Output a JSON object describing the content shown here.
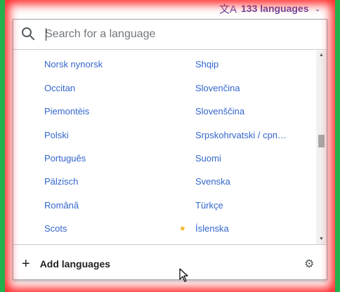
{
  "header": {
    "language_button_label": "133 languages",
    "language_glyph": "文A",
    "chevron": "⌄"
  },
  "search": {
    "placeholder": "Search for a language",
    "icon": "search-icon"
  },
  "languages": {
    "left": [
      "Norsk nynorsk",
      "Occitan",
      "Piemontèis",
      "Polski",
      "Português",
      "Pälzisch",
      "Română",
      "Scots"
    ],
    "right": [
      "Shqip",
      "Slovenčina",
      "Slovenščina",
      "Srpskohrvatski / срп…",
      "Suomi",
      "Svenska",
      "Türkçe",
      "Íslenska"
    ],
    "starred": "Íslenska"
  },
  "footer": {
    "add_languages_label": "Add languages",
    "plus_glyph": "+",
    "settings_icon": "gear-icon"
  },
  "colors": {
    "link": "#3366cc",
    "accent": "#6b4ba1",
    "star": "#f2b21b"
  }
}
